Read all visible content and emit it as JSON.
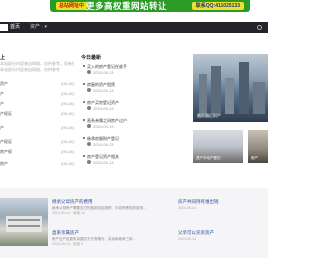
{
  "banner": {
    "pill": "总站网址中",
    "headline": "更多高权重网站转让",
    "qq": "联系QQ:411025133"
  },
  "nav": {
    "logo_text": "首页",
    "menu": "资产 ·",
    "menu_arrow": "▾"
  },
  "left": {
    "title": "上",
    "hint1": "本站部分内容来自网络，仅供参考，如有侵权请联系删除处理",
    "hint2": "本站部分内容来自网络，仅供参考",
    "rows": [
      {
        "label": "资产",
        "date": "(09-14)"
      },
      {
        "label": "产",
        "date": "(09-14)"
      },
      {
        "label": "产",
        "date": "(09-14)"
      },
      {
        "label": "产权证",
        "date": "(09-14)"
      },
      {
        "label": "产",
        "date": "(09-14)"
      },
      {
        "label": "产权证",
        "date": "(09-14)"
      },
      {
        "label": "房产权",
        "date": "(09-14)"
      },
      {
        "label": "房产",
        "date": "(09-14)"
      }
    ]
  },
  "news": {
    "title": "今日最新",
    "items": [
      {
        "title": "买入的房产登记在谁手",
        "date": "2024-09-13"
      },
      {
        "title": "房屋的资产租赁",
        "date": "2024-09-13"
      },
      {
        "title": "房产买房登记资产",
        "date": "2024-09-13"
      },
      {
        "title": "直系亲属之间房产过户",
        "date": "2024-09-13"
      },
      {
        "title": "继承房屋财产登记",
        "date": "2024-09-13"
      },
      {
        "title": "房产登记资产相关",
        "date": "2024-09-13"
      }
    ]
  },
  "hero": {
    "caption": "婚前婚后财产"
  },
  "thumbs": [
    {
      "caption": "资产不动产登记"
    },
    {
      "caption": "房产"
    }
  ],
  "articles": [
    {
      "title": "继承父母房产的费用",
      "snippet": "继承父母房产需要支付的费用包括契税、印花税等相关费用...",
      "meta": "2024-09-14 · 阅读 12"
    },
    {
      "title": "直系亲属房产",
      "snippet": "房产过户给直系亲属的方式有赠与、买卖和继承三种...",
      "meta": "2024-09-14 · 阅读 9"
    }
  ],
  "side": [
    {
      "title": "房产共同持有谁出钱",
      "meta": "2024-09-14"
    },
    {
      "title": "父亲可以买房资产",
      "meta": "2024-09-14"
    }
  ]
}
